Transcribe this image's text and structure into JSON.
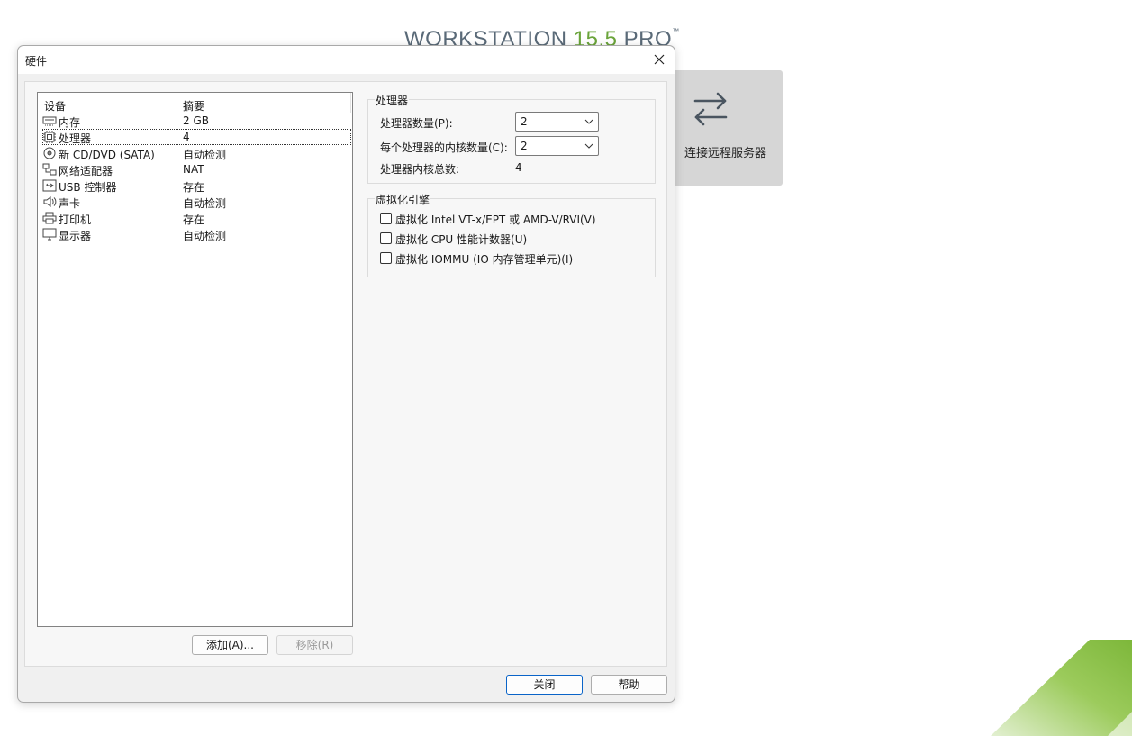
{
  "background": {
    "brand": {
      "prefix": "WORKSTATION ",
      "version": "15.5",
      "suffix": " PRO",
      "tm": "™"
    },
    "remote_tile": {
      "label": "连接远程服务器",
      "icon": "swap-arrows-icon"
    },
    "colors": {
      "brand_green": "#6aa43a",
      "tile_bg": "#d6d6d6"
    }
  },
  "dialog": {
    "title": "硬件",
    "devices": {
      "header": {
        "device": "设备",
        "summary": "摘要"
      },
      "rows": [
        {
          "name": "内存",
          "summary": "2 GB",
          "icon": "memory-icon"
        },
        {
          "name": "处理器",
          "summary": "4",
          "icon": "cpu-icon"
        },
        {
          "name": "新 CD/DVD (SATA)",
          "summary": "自动检测",
          "icon": "disc-icon"
        },
        {
          "name": "网络适配器",
          "summary": "NAT",
          "icon": "network-icon"
        },
        {
          "name": "USB 控制器",
          "summary": "存在",
          "icon": "usb-icon"
        },
        {
          "name": "声卡",
          "summary": "自动检测",
          "icon": "speaker-icon"
        },
        {
          "name": "打印机",
          "summary": "存在",
          "icon": "printer-icon"
        },
        {
          "name": "显示器",
          "summary": "自动检测",
          "icon": "monitor-icon"
        }
      ],
      "selected": "处理器"
    },
    "buttons": {
      "add": "添加(A)...",
      "remove": "移除(R)",
      "close": "关闭",
      "help": "帮助"
    },
    "processor": {
      "group_title": "处理器",
      "count_label": "处理器数量(P):",
      "count_value": "2",
      "cores_label": "每个处理器的内核数量(C):",
      "cores_value": "2",
      "total_label": "处理器内核总数:",
      "total_value": "4"
    },
    "virtualization": {
      "group_title": "虚拟化引擎",
      "options": [
        {
          "label": "虚拟化 Intel VT-x/EPT 或 AMD-V/RVI(V)",
          "checked": false
        },
        {
          "label": "虚拟化 CPU 性能计数器(U)",
          "checked": false
        },
        {
          "label": "虚拟化 IOMMU (IO 内存管理单元)(I)",
          "checked": false
        }
      ]
    }
  }
}
